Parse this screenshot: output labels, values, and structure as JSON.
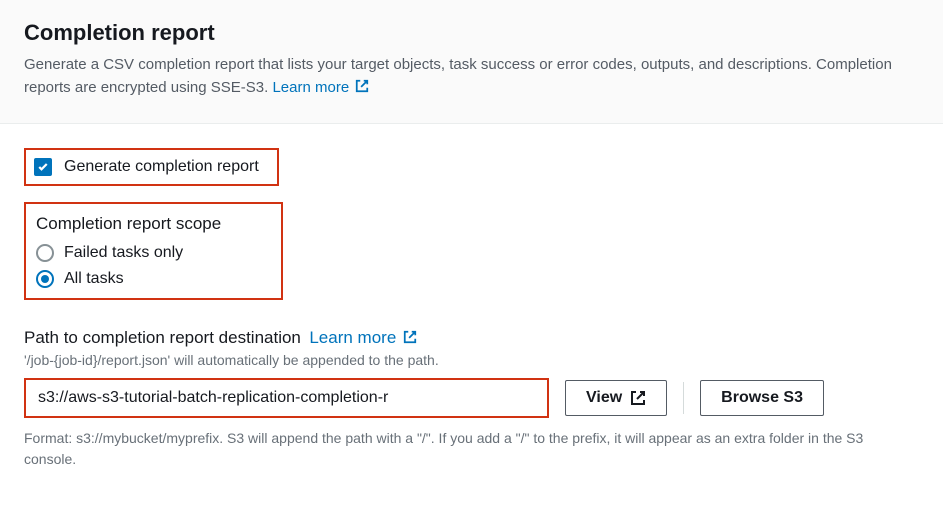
{
  "header": {
    "title": "Completion report",
    "description_before": "Generate a CSV completion report that lists your target objects, task success or error codes, outputs, and descriptions. Completion reports are encrypted using SSE-S3. ",
    "learn_more": "Learn more"
  },
  "generate": {
    "label": "Generate completion report",
    "checked": true
  },
  "scope": {
    "title": "Completion report scope",
    "options": [
      {
        "label": "Failed tasks only",
        "selected": false
      },
      {
        "label": "All tasks",
        "selected": true
      }
    ]
  },
  "destination": {
    "label": "Path to completion report destination",
    "learn_more": "Learn more",
    "hint": "'/job-{job-id}/report.json' will automatically be appended to the path.",
    "value": "s3://aws-s3-tutorial-batch-replication-completion-r",
    "view_label": "View",
    "browse_label": "Browse S3",
    "format_hint": "Format: s3://mybucket/myprefix. S3 will append the path with a \"/\". If you add a \"/\" to the prefix, it will appear as an extra folder in the S3 console."
  }
}
